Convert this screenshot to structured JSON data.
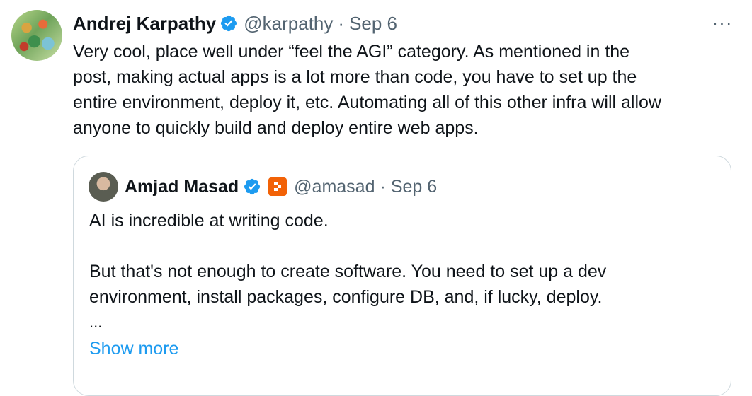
{
  "tweet": {
    "author_name": "Andrej Karpathy",
    "author_handle": "@karpathy",
    "separator": "·",
    "date": "Sep 6",
    "more_label": "···",
    "text_lines": [
      "Very cool, place well under “feel the AGI” category.  As mentioned in the",
      "post, making actual apps is a lot more than code, you have to set up the",
      "entire environment, deploy it, etc. Automating all of this other infra will allow",
      "anyone to quickly build and deploy entire web apps."
    ]
  },
  "quote": {
    "author_name": "Amjad Masad",
    "author_handle": "@amasad",
    "separator": "·",
    "date": "Sep 6",
    "paragraph1": "AI is incredible at writing code.",
    "paragraph2_lines": [
      "But that's not enough to create software. You need to set up a dev",
      "environment, install packages, configure DB, and, if lucky, deploy."
    ],
    "ellipsis": "...",
    "show_more": "Show more"
  },
  "colors": {
    "verified_blue": "#1d9bf0",
    "affiliate_badge": "#f26207",
    "secondary_text": "#536471",
    "border": "#cfd9de"
  },
  "icons": {
    "verified": "verified-badge-icon",
    "affiliate": "replit-logo-icon",
    "more": "more-horizontal-icon"
  }
}
